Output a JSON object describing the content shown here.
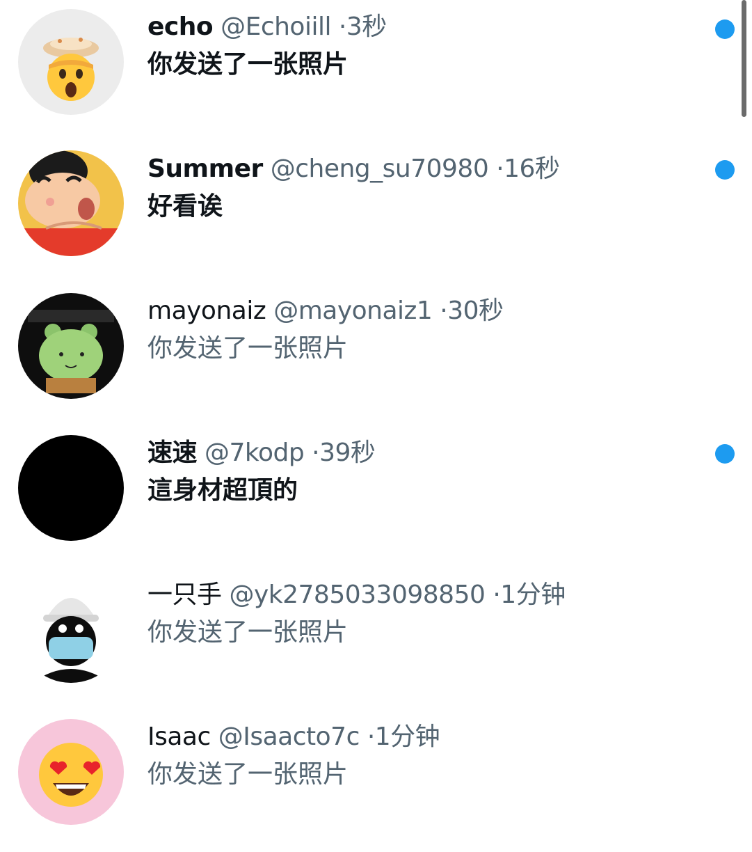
{
  "messages": [
    {
      "name": "echo",
      "handle": "@Echoiill",
      "time": "3秒",
      "text": "你发送了一张照片",
      "unread": true,
      "avatar_icon": "exploding-head-emoji-icon"
    },
    {
      "name": "Summer",
      "handle": "@cheng_su70980",
      "time": "16秒",
      "text": "好看诶",
      "unread": true,
      "avatar_icon": "cartoon-boy-avatar-icon"
    },
    {
      "name": "mayonaiz",
      "handle": "@mayonaiz1",
      "time": "30秒",
      "text": "你发送了一张照片",
      "unread": false,
      "avatar_icon": "green-cartoon-creature-avatar-icon"
    },
    {
      "name": "速速",
      "handle": "@7kodp",
      "time": "39秒",
      "text": "這身材超頂的",
      "unread": true,
      "avatar_icon": "black-circle-avatar-icon"
    },
    {
      "name": "一只手",
      "handle": "@yk2785033098850",
      "time": "1分钟",
      "text": "你发送了一张照片",
      "unread": false,
      "avatar_icon": "masked-person-avatar-icon"
    },
    {
      "name": "Isaac",
      "handle": "@Isaacto7c",
      "time": "1分钟",
      "text": "你发送了一张照片",
      "unread": false,
      "avatar_icon": "heart-eyes-emoji-icon"
    }
  ],
  "separator": "·",
  "colors": {
    "unread_dot": "#1d9bf0",
    "primary_text": "#0f1419",
    "secondary_text": "#536471"
  }
}
